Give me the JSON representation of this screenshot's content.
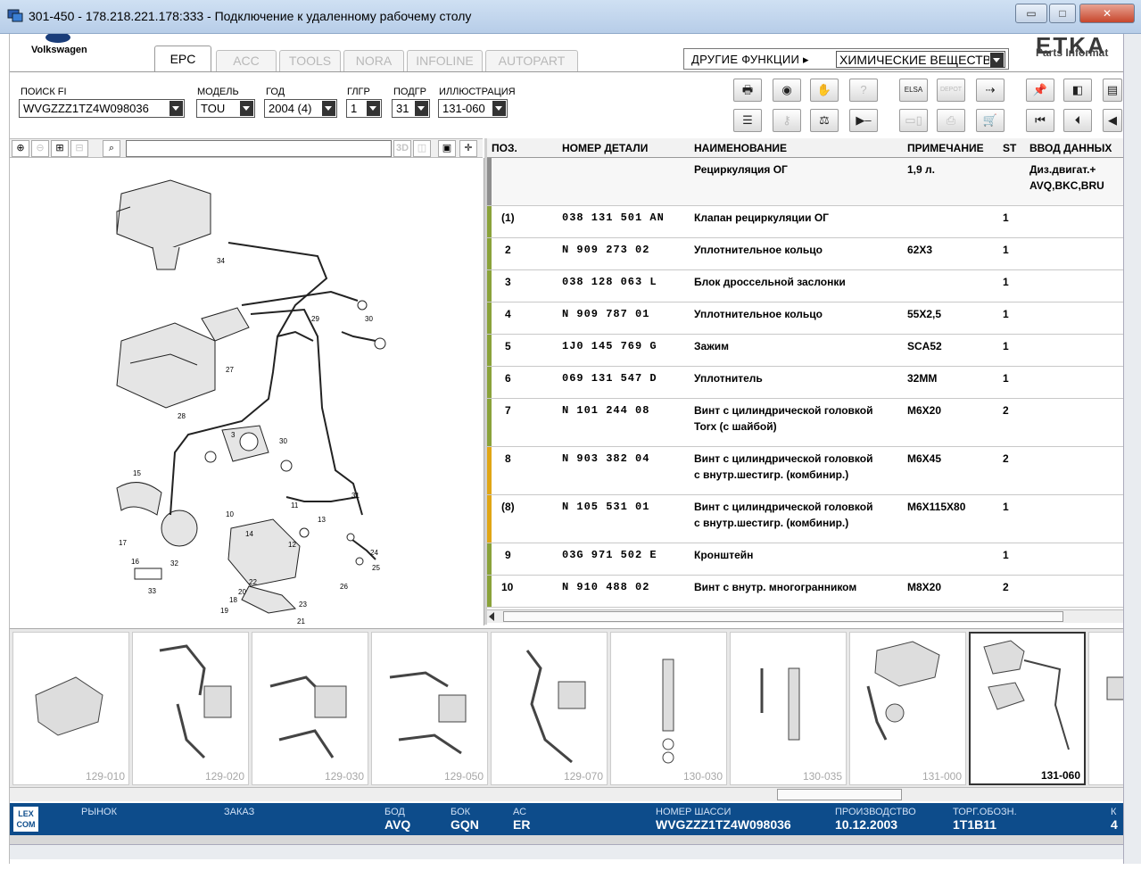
{
  "window": {
    "title": "301-450 - 178.218.221.178:333 - Подключение к удаленному рабочему столу",
    "minimize_label": "▭",
    "maximize_label": "□",
    "close_label": "✕"
  },
  "header": {
    "brand": "Volkswagen",
    "tabs": [
      "EPC",
      "ACC",
      "TOOLS",
      "NORA",
      "INFOLINE",
      "AUTOPART"
    ],
    "active_tab": "EPC",
    "other_functions_label": "ДРУГИЕ ФУНКЦИИ ▸",
    "other_functions_value": "ХИМИЧЕСКИЕ ВЕЩЕСТВА",
    "etka_logo": "ETKA",
    "etka_sub": "Parts Informat"
  },
  "filters": {
    "search_fi": {
      "label": "ПОИСК FI",
      "value": "WVGZZZ1TZ4W098036"
    },
    "model": {
      "label": "МОДЕЛЬ",
      "value": "TOU"
    },
    "year": {
      "label": "ГОД",
      "value": "2004 (4)"
    },
    "glgr": {
      "label": "ГЛГР",
      "value": "1"
    },
    "podgr": {
      "label": "ПОДГР",
      "value": "31"
    },
    "illustration": {
      "label": "ИЛЛЮСТРАЦИЯ",
      "value": "131-060"
    }
  },
  "toolbar": {
    "row1": [
      {
        "name": "print-icon",
        "glyph": "🖶"
      },
      {
        "name": "dealer-icon",
        "glyph": "◉"
      },
      {
        "name": "handshake-icon",
        "glyph": "✋"
      },
      {
        "name": "search-disabled-icon",
        "glyph": "?"
      },
      {
        "name": "elsa-icon",
        "glyph": "ELSA"
      },
      {
        "name": "depot-icon",
        "glyph": "DEPOT"
      },
      {
        "name": "cart-transfer-icon",
        "glyph": "⇢"
      },
      {
        "name": "pin-icon",
        "glyph": "📌"
      },
      {
        "name": "back-page-icon",
        "glyph": "◧"
      },
      {
        "name": "page-icon",
        "glyph": "▤"
      }
    ],
    "row2": [
      {
        "name": "list-icon",
        "glyph": "☰"
      },
      {
        "name": "key-icon",
        "glyph": "⚷"
      },
      {
        "name": "scale-icon",
        "glyph": "⚖"
      },
      {
        "name": "play-minus-icon",
        "glyph": "▶–"
      },
      {
        "name": "compare-icon",
        "glyph": "▭▯"
      },
      {
        "name": "stamp-icon",
        "glyph": "⎙"
      },
      {
        "name": "cart-icon",
        "glyph": "🛒"
      },
      {
        "name": "first-icon",
        "glyph": "⏮"
      },
      {
        "name": "prev-icon",
        "glyph": "⏴"
      },
      {
        "name": "prev2-icon",
        "glyph": "◀"
      }
    ]
  },
  "zoom_toolbar": {
    "input_value": "",
    "label_3d": "3D"
  },
  "table": {
    "columns": [
      "ПОЗ.",
      "НОМЕР ДЕТАЛИ",
      "НАИМЕНОВАНИЕ",
      "ПРИМЕЧАНИЕ",
      "ST",
      "ВВОД ДАННЫХ"
    ],
    "header_row": {
      "name": "Рециркуляция ОГ",
      "note": "1,9 л.",
      "entry": "Диз.двигат.+",
      "entry2": "AVQ,BKC,BRU"
    },
    "rows": [
      {
        "pos": "(1)",
        "part": "038  131  501  AN",
        "name": "Клапан рециркуляции ОГ",
        "name2": "",
        "note": "",
        "st": "1",
        "color": "green"
      },
      {
        "pos": "2",
        "part": "N    909  273  02",
        "name": "Уплотнительное кольцо",
        "name2": "",
        "note": "62X3",
        "st": "1",
        "color": "green"
      },
      {
        "pos": "3",
        "part": "038  128  063  L",
        "name": "Блок дроссельной заслонки",
        "name2": "",
        "note": "",
        "st": "1",
        "color": "green"
      },
      {
        "pos": "4",
        "part": "N    909  787  01",
        "name": "Уплотнительное кольцо",
        "name2": "",
        "note": "55X2,5",
        "st": "1",
        "color": "green"
      },
      {
        "pos": "5",
        "part": "1J0  145  769  G",
        "name": "Зажим",
        "name2": "",
        "note": "SCA52",
        "st": "1",
        "color": "green"
      },
      {
        "pos": "6",
        "part": "069  131  547  D",
        "name": "Уплотнитель",
        "name2": "",
        "note": "32MM",
        "st": "1",
        "color": "green"
      },
      {
        "pos": "7",
        "part": "N    101  244  08",
        "name": "Винт с цилиндрической головкой",
        "name2": "Torx (с шайбой)",
        "note": "M6X20",
        "st": "2",
        "color": "green"
      },
      {
        "pos": "8",
        "part": "N    903  382  04",
        "name": "Винт с цилиндрической головкой",
        "name2": "с внутр.шестигр. (комбинир.)",
        "note": "M6X45",
        "st": "2",
        "color": "orange"
      },
      {
        "pos": "(8)",
        "part": "N    105  531  01",
        "name": "Винт с цилиндрической головкой",
        "name2": "с внутр.шестигр. (комбинир.)",
        "note": "M6X115X80",
        "st": "1",
        "color": "orange"
      },
      {
        "pos": "9",
        "part": "03G  971  502  E",
        "name": "Кронштейн",
        "name2": "",
        "note": "",
        "st": "1",
        "color": "green"
      },
      {
        "pos": "10",
        "part": "N    910  488  02",
        "name": "Винт с внутр. многогранником",
        "name2": "",
        "note": "M8X20",
        "st": "2",
        "color": "green"
      }
    ]
  },
  "illustration_numbers": [
    "34",
    "27",
    "28",
    "29",
    "30",
    "3",
    "30",
    "31",
    "11",
    "13",
    "12",
    "14",
    "10",
    "17",
    "32",
    "16",
    "33",
    "15",
    "18",
    "19",
    "20",
    "21",
    "22",
    "23",
    "24",
    "25",
    "26"
  ],
  "thumbnails": [
    {
      "label": "129-010",
      "strong": false,
      "selected": false
    },
    {
      "label": "129-020",
      "strong": false,
      "selected": false
    },
    {
      "label": "129-030",
      "strong": true,
      "selected": false
    },
    {
      "label": "129-050",
      "strong": false,
      "selected": false
    },
    {
      "label": "129-070",
      "strong": false,
      "selected": false
    },
    {
      "label": "130-030",
      "strong": true,
      "selected": false
    },
    {
      "label": "130-035",
      "strong": false,
      "selected": false
    },
    {
      "label": "131-000",
      "strong": false,
      "selected": false
    },
    {
      "label": "131-060",
      "strong": true,
      "selected": true
    }
  ],
  "status": {
    "logo": "LEX COM",
    "market_label": "РЫНОК",
    "market_value": "",
    "order_label": "ЗАКАЗ",
    "order_value": "",
    "bod_label": "БОД",
    "bod_value": "AVQ",
    "bok_label": "БОК",
    "bok_value": "GQN",
    "ac_label": "АС",
    "ac_value": "ER",
    "chassis_label": "НОМЕР ШАССИ",
    "chassis_value": "WVGZZZ1TZ4W098036",
    "production_label": "ПРОИЗВОДСТВО",
    "production_value": "10.12.2003",
    "trade_label": "ТОРГ.ОБОЗН.",
    "trade_value": "1T1B11",
    "k_label": "К",
    "k_value": "4"
  }
}
